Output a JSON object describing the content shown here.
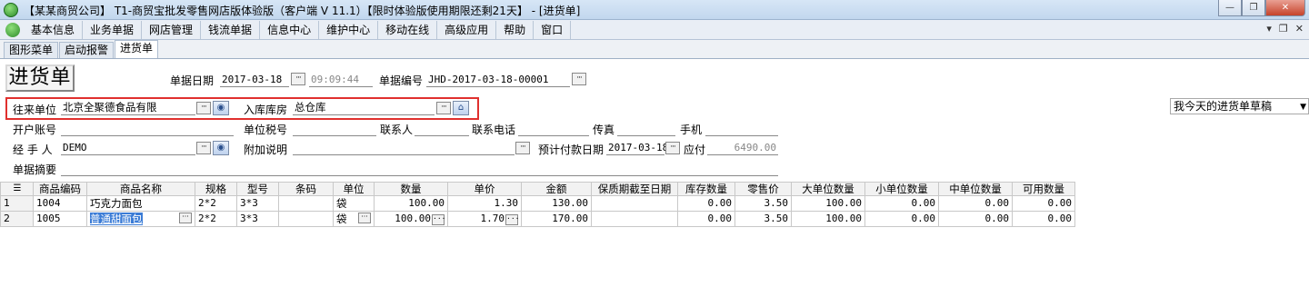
{
  "window": {
    "title": "【某某商贸公司】 T1-商贸宝批发零售网店版体验版（客户端 V 11.1）【限时体验版使用期限还剩21天】 - [进货单]",
    "minimize": "—",
    "restore": "❐",
    "close": "✕"
  },
  "menu": {
    "items": [
      "基本信息",
      "业务单据",
      "网店管理",
      "钱流单据",
      "信息中心",
      "维护中心",
      "移动在线",
      "高级应用",
      "帮助",
      "窗口"
    ],
    "ctrl_min": "▾",
    "ctrl_restore": "❐",
    "ctrl_close": "✕"
  },
  "tabs": [
    "图形菜单",
    "启动报警",
    "进货单"
  ],
  "form": {
    "doc_title": "进货单",
    "date_label": "单据日期",
    "date_value": "2017-03-18",
    "time_value": "09:09:44",
    "docno_label": "单据编号",
    "docno_value": "JHD-2017-03-18-00001",
    "partner_label": "往来单位",
    "partner_value": "北京全聚德食品有限",
    "warehouse_label": "入库库房",
    "warehouse_value": "总仓库",
    "draft_select": "我今天的进货单草稿",
    "bank_label": "开户账号",
    "tax_label": "单位税号",
    "contact_label": "联系人",
    "phone_label": "联系电话",
    "fax_label": "传真",
    "mobile_label": "手机",
    "handler_label": "经 手 人",
    "handler_value": "DEMO",
    "note_label": "附加说明",
    "paydate_label": "预计付款日期",
    "paydate_value": "2017-03-18",
    "payable_label": "应付",
    "payable_value": "6490.00",
    "summary_label": "单据摘要"
  },
  "grid": {
    "headers": [
      "商品编码",
      "商品名称",
      "规格",
      "型号",
      "条码",
      "单位",
      "数量",
      "单价",
      "金额",
      "保质期截至日期",
      "库存数量",
      "零售价",
      "大单位数量",
      "小单位数量",
      "中单位数量",
      "可用数量"
    ],
    "rows": [
      {
        "no": "1",
        "code": "1004",
        "name": "巧克力面包",
        "spec": "2*2",
        "model": "3*3",
        "barcode": "",
        "unit": "袋",
        "qty": "100.00",
        "price": "1.30",
        "amount": "130.00",
        "expiry": "",
        "stock": "0.00",
        "retail": "3.50",
        "big_qty": "100.00",
        "small_qty": "0.00",
        "mid_qty": "0.00",
        "avail": "0.00"
      },
      {
        "no": "2",
        "code": "1005",
        "name": "普通甜面包",
        "spec": "2*2",
        "model": "3*3",
        "barcode": "",
        "unit": "袋",
        "qty": "100.00",
        "price": "1.70",
        "amount": "170.00",
        "expiry": "",
        "stock": "0.00",
        "retail": "3.50",
        "big_qty": "100.00",
        "small_qty": "0.00",
        "mid_qty": "0.00",
        "avail": "0.00"
      }
    ]
  }
}
